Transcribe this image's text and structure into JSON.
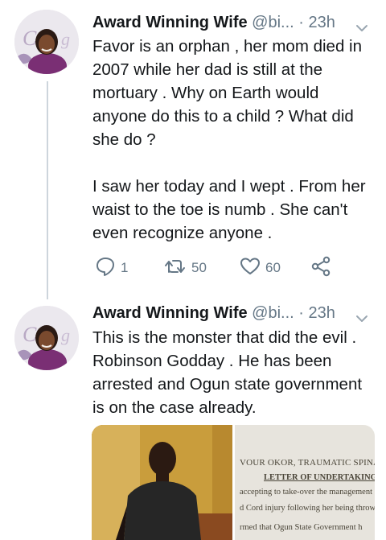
{
  "tweets": [
    {
      "author_name": "Award Winning Wife",
      "handle": "@bi...",
      "separator": "·",
      "time": "23h",
      "text": "Favor is an orphan , her mom died in 2007 while her dad is still at the mortuary . Why on Earth would anyone do this to a child ? What did she do ?\n\nI saw her today and I wept . From her waist to the toe is numb . She can't even recognize anyone .",
      "actions": {
        "replies": "1",
        "retweets": "50",
        "likes": "60"
      }
    },
    {
      "author_name": "Award Winning Wife",
      "handle": "@bi...",
      "separator": "·",
      "time": "23h",
      "text": "This is the monster that did the evil . Robinson Godday . He has been arrested and Ogun state government is on the case already.",
      "media": {
        "letter_lines": [
          "VOUR OKOR, TRAUMATIC SPINAL C",
          "LETTER OF UNDERTAKING",
          "accepting to take-over the management o",
          "d Cord injury following her being thrown in",
          "rmed that Ogun State Government h"
        ]
      }
    }
  ],
  "colors": {
    "text": "#14171a",
    "secondary": "#657786",
    "thread_line": "#cdd5dc"
  }
}
